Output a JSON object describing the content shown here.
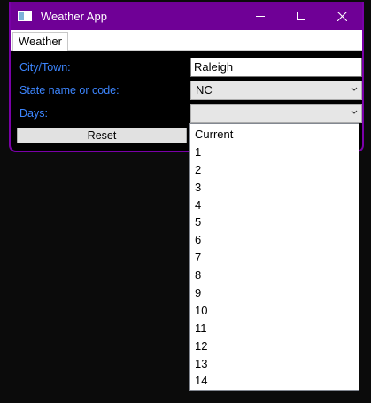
{
  "window": {
    "title": "Weather App",
    "accent_color": "#6f0096",
    "icon": "app-window-icon"
  },
  "window_controls": {
    "minimize_icon": "minimize-icon",
    "maximize_icon": "maximize-icon",
    "close_icon": "close-icon"
  },
  "tabs": [
    {
      "label": "Weather",
      "selected": true
    }
  ],
  "form": {
    "city_label": "City/Town:",
    "city_value": "Raleigh",
    "state_label": "State name or code:",
    "state_value": "NC",
    "days_label": "Days:",
    "days_value": "",
    "reset_label": "Reset",
    "label_color": "#3d86ff"
  },
  "days_options": [
    "Current",
    "1",
    "2",
    "3",
    "4",
    "5",
    "6",
    "7",
    "8",
    "9",
    "10",
    "11",
    "12",
    "13",
    "14"
  ]
}
